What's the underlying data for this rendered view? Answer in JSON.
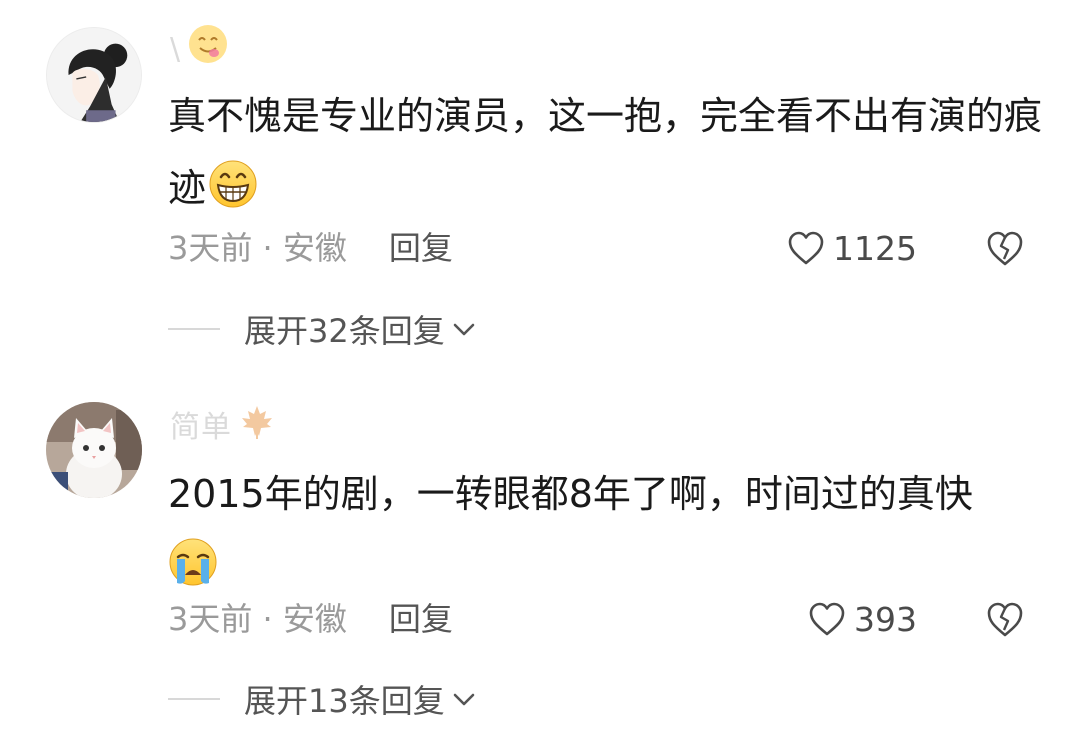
{
  "comments": [
    {
      "username": "\\",
      "text": "真不愧是专业的演员，这一抱，完全看不出有演的痕迹",
      "time": "3天前",
      "separator": " · ",
      "location": "安徽",
      "reply_label": "回复",
      "likes": "1125",
      "expand_label": "展开32条回复",
      "badge_icon": "yum-emoji-icon",
      "inline_emoji": "grin-emoji-icon"
    },
    {
      "username": "简单",
      "text": "2015年的剧，一转眼都8年了啊，时间过的真快",
      "time": "3天前",
      "separator": " · ",
      "location": "安徽",
      "reply_label": "回复",
      "likes": "393",
      "expand_label": "展开13条回复",
      "badge_icon": "maple-leaf-icon",
      "inline_emoji": "crying-emoji-icon"
    }
  ],
  "colors": {
    "text": "#1a1a1a",
    "meta": "#9a9a9a",
    "action": "#555555",
    "emoji_yellow": "#ffd04a",
    "tear_blue": "#5ab0ea",
    "maple": "#f3c9a0"
  }
}
